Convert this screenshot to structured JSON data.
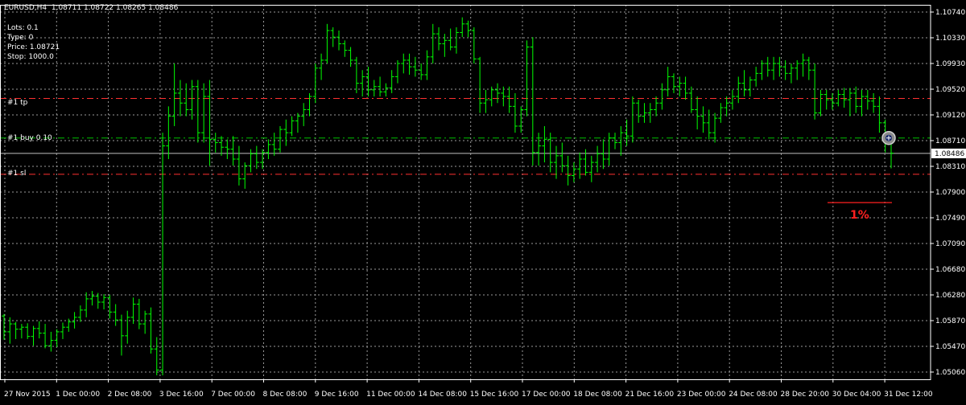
{
  "header": {
    "symbol": "EURUSD,H4",
    "ohlc": "1.08711 1.08722 1.08265 1.08486"
  },
  "trade_info": {
    "lots": "Lots: 0.1",
    "type": "Type: 0",
    "price": "Price: 1.08721",
    "stop": "Stop: 1000.0"
  },
  "levels": {
    "tp_label": "#1 tp",
    "buy_label": "#1 buy 0.10",
    "sl_label": "#1 sl"
  },
  "percent_label": "1%",
  "colors": {
    "background": "#000000",
    "grid": "#9a9a9a",
    "bars": "#00ff00",
    "tp_line": "#ff3030",
    "sl_line": "#ff3030",
    "buy_line": "#00c000",
    "current_price_line": "#c0c0c0",
    "percent_line": "#ff2020"
  },
  "chart_data": {
    "type": "ohlc",
    "ylim": [
      1.0506,
      1.1074
    ],
    "y_ticks": [
      "1.10740",
      "1.10330",
      "1.09930",
      "1.09520",
      "1.09120",
      "1.08710",
      "1.08310",
      "1.07900",
      "1.07490",
      "1.07090",
      "1.06680",
      "1.06280",
      "1.05870",
      "1.05470",
      "1.05060"
    ],
    "current_price": "1.08486",
    "tp_price": 1.0932,
    "buy_price": 1.0872,
    "sl_price": 1.0817,
    "percent_line_price": 1.0774,
    "x_ticks": [
      "27 Nov 2015",
      "1 Dec 00:00",
      "2 Dec 08:00",
      "3 Dec 16:00",
      "7 Dec 00:00",
      "8 Dec 08:00",
      "9 Dec 16:00",
      "11 Dec 00:00",
      "14 Dec 08:00",
      "15 Dec 16:00",
      "17 Dec 00:00",
      "18 Dec 08:00",
      "21 Dec 16:00",
      "23 Dec 00:00",
      "24 Dec 08:00",
      "28 Dec 20:00",
      "30 Dec 04:00",
      "31 Dec 12:00"
    ],
    "bars": [
      [
        1.0602,
        1.0605,
        1.0566,
        1.0578
      ],
      [
        1.0578,
        1.06,
        1.056,
        1.059
      ],
      [
        1.059,
        1.0593,
        1.0567,
        1.0582
      ],
      [
        1.0582,
        1.059,
        1.0568,
        1.0585
      ],
      [
        1.0585,
        1.0591,
        1.0567,
        1.0571
      ],
      [
        1.0571,
        1.0587,
        1.0557,
        1.0583
      ],
      [
        1.0583,
        1.0594,
        1.0568,
        1.0576
      ],
      [
        1.0576,
        1.059,
        1.0553,
        1.0557
      ],
      [
        1.0557,
        1.0578,
        1.0548,
        1.0565
      ],
      [
        1.0565,
        1.0582,
        1.0555,
        1.0578
      ],
      [
        1.0578,
        1.0592,
        1.0567,
        1.0585
      ],
      [
        1.0585,
        1.0598,
        1.0578,
        1.0593
      ],
      [
        1.0593,
        1.0608,
        1.0583,
        1.06
      ],
      [
        1.06,
        1.0618,
        1.0593,
        1.0611
      ],
      [
        1.0611,
        1.0638,
        1.06,
        1.0628
      ],
      [
        1.0628,
        1.064,
        1.0618,
        1.0632
      ],
      [
        1.0632,
        1.0637,
        1.0613,
        1.0623
      ],
      [
        1.0623,
        1.0635,
        1.0612,
        1.063
      ],
      [
        1.063,
        1.0634,
        1.0598,
        1.0608
      ],
      [
        1.0608,
        1.062,
        1.0587,
        1.0596
      ],
      [
        1.0596,
        1.0604,
        1.0542,
        1.0572
      ],
      [
        1.0572,
        1.061,
        1.056,
        1.06
      ],
      [
        1.06,
        1.063,
        1.059,
        1.062
      ],
      [
        1.062,
        1.0628,
        1.0582,
        1.059
      ],
      [
        1.059,
        1.061,
        1.0575,
        1.0605
      ],
      [
        1.0605,
        1.0615,
        1.0545,
        1.0552
      ],
      [
        1.0552,
        1.057,
        1.0512,
        1.052
      ],
      [
        1.052,
        1.088,
        1.0512,
        1.086
      ],
      [
        1.086,
        1.092,
        1.084,
        1.0905
      ],
      [
        1.0905,
        1.0985,
        1.089,
        1.094
      ],
      [
        1.094,
        1.096,
        1.0905,
        1.0925
      ],
      [
        1.0925,
        1.0955,
        1.0905,
        1.0915
      ],
      [
        1.0915,
        1.096,
        1.09,
        1.095
      ],
      [
        1.095,
        1.096,
        1.0865,
        1.088
      ],
      [
        1.088,
        1.0955,
        1.0865,
        1.0935
      ],
      [
        1.0935,
        1.096,
        1.083,
        1.087
      ],
      [
        1.087,
        1.088,
        1.085,
        1.0865
      ],
      [
        1.0865,
        1.0875,
        1.0845,
        1.0858
      ],
      [
        1.0858,
        1.087,
        1.084,
        1.0855
      ],
      [
        1.0855,
        1.0875,
        1.083,
        1.084
      ],
      [
        1.084,
        1.086,
        1.08,
        1.081
      ],
      [
        1.081,
        1.0835,
        1.0795,
        1.083
      ],
      [
        1.083,
        1.0855,
        1.082,
        1.0848
      ],
      [
        1.0848,
        1.086,
        1.0825,
        1.0835
      ],
      [
        1.0835,
        1.0855,
        1.0825,
        1.085
      ],
      [
        1.085,
        1.087,
        1.084,
        1.0862
      ],
      [
        1.0862,
        1.088,
        1.0845,
        1.0855
      ],
      [
        1.0855,
        1.089,
        1.085,
        1.0885
      ],
      [
        1.0885,
        1.09,
        1.086,
        1.088
      ],
      [
        1.088,
        1.0905,
        1.0875,
        1.0898
      ],
      [
        1.0898,
        1.091,
        1.088,
        1.0905
      ],
      [
        1.0905,
        1.0925,
        1.089,
        1.0915
      ],
      [
        1.0915,
        1.094,
        1.0905,
        1.0935
      ],
      [
        1.0935,
        1.0985,
        1.0925,
        1.0978
      ],
      [
        1.0978,
        1.1,
        1.096,
        1.099
      ],
      [
        1.099,
        1.1045,
        1.0985,
        1.1035
      ],
      [
        1.1035,
        1.104,
        1.101,
        1.1025
      ],
      [
        1.1025,
        1.1035,
        1.1005,
        1.1015
      ],
      [
        1.1015,
        1.102,
        1.0995,
        1.1005
      ],
      [
        1.1005,
        1.101,
        1.098,
        1.099
      ],
      [
        1.099,
        1.0995,
        1.094,
        1.0955
      ],
      [
        1.0955,
        1.0975,
        1.0935,
        1.0965
      ],
      [
        1.0965,
        1.098,
        1.0935,
        1.0945
      ],
      [
        1.0945,
        1.096,
        1.0935,
        1.095
      ],
      [
        1.095,
        1.0965,
        1.0935,
        1.0942
      ],
      [
        1.0942,
        1.0955,
        1.0935,
        1.0948
      ],
      [
        1.0948,
        1.0975,
        1.094,
        1.0965
      ],
      [
        1.0965,
        1.099,
        1.0955,
        1.0985
      ],
      [
        1.0985,
        1.1,
        1.097,
        1.099
      ],
      [
        1.099,
        1.1,
        1.0968,
        1.098
      ],
      [
        1.098,
        1.0995,
        1.0965,
        1.0975
      ],
      [
        1.0975,
        1.0985,
        1.096,
        1.0968
      ],
      [
        1.0968,
        1.1005,
        1.096,
        1.0995
      ],
      [
        1.0995,
        1.1045,
        1.0985,
        1.103
      ],
      [
        1.103,
        1.104,
        1.1005,
        1.1015
      ],
      [
        1.1015,
        1.103,
        1.0995,
        1.102
      ],
      [
        1.102,
        1.1038,
        1.1005,
        1.101
      ],
      [
        1.101,
        1.104,
        1.1,
        1.1032
      ],
      [
        1.1032,
        1.1055,
        1.1025,
        1.1045
      ],
      [
        1.1045,
        1.105,
        1.1025,
        1.1035
      ],
      [
        1.1035,
        1.104,
        1.0985,
        1.0992
      ],
      [
        1.0992,
        1.0995,
        1.091,
        1.0925
      ],
      [
        1.0925,
        1.0945,
        1.091,
        1.093
      ],
      [
        1.093,
        1.095,
        1.092,
        1.0945
      ],
      [
        1.0945,
        1.0955,
        1.0925,
        1.094
      ],
      [
        1.094,
        1.095,
        1.092,
        1.0935
      ],
      [
        1.0935,
        1.095,
        1.091,
        1.092
      ],
      [
        1.092,
        1.094,
        1.088,
        1.089
      ],
      [
        1.089,
        1.092,
        1.088,
        1.0915
      ],
      [
        1.0915,
        1.102,
        1.0905,
        1.101
      ],
      [
        1.101,
        1.1025,
        1.083,
        1.085
      ],
      [
        1.085,
        1.088,
        1.083,
        1.086
      ],
      [
        1.086,
        1.089,
        1.0835,
        1.087
      ],
      [
        1.087,
        1.088,
        1.082,
        1.0835
      ],
      [
        1.0835,
        1.086,
        1.081,
        1.0845
      ],
      [
        1.0845,
        1.0865,
        1.082,
        1.083
      ],
      [
        1.083,
        1.0845,
        1.08,
        1.0815
      ],
      [
        1.0815,
        1.0835,
        1.0805,
        1.0825
      ],
      [
        1.0825,
        1.085,
        1.081,
        1.084
      ],
      [
        1.084,
        1.0855,
        1.0815,
        1.082
      ],
      [
        1.082,
        1.0845,
        1.0805,
        1.0835
      ],
      [
        1.0835,
        1.086,
        1.082,
        1.0848
      ],
      [
        1.0848,
        1.087,
        1.0825,
        1.084
      ],
      [
        1.084,
        1.088,
        1.083,
        1.0872
      ],
      [
        1.0872,
        1.088,
        1.0855,
        1.0865
      ],
      [
        1.0865,
        1.089,
        1.0845,
        1.088
      ],
      [
        1.088,
        1.09,
        1.086,
        1.0875
      ],
      [
        1.0875,
        1.0935,
        1.0865,
        1.0925
      ],
      [
        1.0925,
        1.093,
        1.0895,
        1.0905
      ],
      [
        1.0905,
        1.0925,
        1.0895,
        1.091
      ],
      [
        1.091,
        1.0925,
        1.0895,
        1.0915
      ],
      [
        1.0915,
        1.0935,
        1.0905,
        1.0925
      ],
      [
        1.0925,
        1.0955,
        1.0915,
        1.0945
      ],
      [
        1.0945,
        1.098,
        1.0935,
        1.0965
      ],
      [
        1.0965,
        1.097,
        1.094,
        1.095
      ],
      [
        1.095,
        1.0965,
        1.0935,
        1.0955
      ],
      [
        1.0955,
        1.0965,
        1.093,
        1.094
      ],
      [
        1.094,
        1.095,
        1.091,
        1.0915
      ],
      [
        1.0915,
        1.0935,
        1.0885,
        1.0905
      ],
      [
        1.0905,
        1.092,
        1.088,
        1.0895
      ],
      [
        1.0895,
        1.0915,
        1.087,
        1.088
      ],
      [
        1.088,
        1.091,
        1.0865,
        1.0902
      ],
      [
        1.0902,
        1.0925,
        1.0895,
        1.0918
      ],
      [
        1.0918,
        1.0935,
        1.0905,
        1.0925
      ],
      [
        1.0925,
        1.0945,
        1.0915,
        1.0935
      ],
      [
        1.0935,
        1.0965,
        1.0925,
        1.0955
      ],
      [
        1.0955,
        1.0975,
        1.0935,
        1.0945
      ],
      [
        1.0945,
        1.0965,
        1.0935,
        1.096
      ],
      [
        1.096,
        1.098,
        1.095,
        1.097
      ],
      [
        1.097,
        1.099,
        1.096,
        1.0985
      ],
      [
        1.0985,
        1.0995,
        1.0965,
        1.0975
      ],
      [
        1.0975,
        1.0995,
        1.096,
        1.0985
      ],
      [
        1.0985,
        1.0995,
        1.0965,
        1.098
      ],
      [
        1.098,
        1.099,
        1.096,
        1.097
      ],
      [
        1.097,
        1.0985,
        1.0955,
        1.0978
      ],
      [
        1.0978,
        1.099,
        1.096,
        1.0985
      ],
      [
        1.0985,
        1.1,
        1.0965,
        1.099
      ],
      [
        1.099,
        1.0995,
        1.096,
        1.0975
      ],
      [
        1.0975,
        1.0985,
        1.09,
        1.091
      ],
      [
        1.091,
        1.0945,
        1.0905,
        1.0938
      ],
      [
        1.0938,
        1.0945,
        1.0915,
        1.093
      ],
      [
        1.093,
        1.094,
        1.0915,
        1.0925
      ],
      [
        1.0925,
        1.0945,
        1.092,
        1.0938
      ],
      [
        1.0938,
        1.0948,
        1.0918,
        1.093
      ],
      [
        1.093,
        1.0948,
        1.0905,
        1.094
      ],
      [
        1.094,
        1.095,
        1.091,
        1.092
      ],
      [
        1.092,
        1.0945,
        1.0905,
        1.0935
      ],
      [
        1.0935,
        1.0945,
        1.0915,
        1.0928
      ],
      [
        1.0928,
        1.094,
        1.091,
        1.092
      ],
      [
        1.092,
        1.0935,
        1.088,
        1.0895
      ],
      [
        1.0895,
        1.09,
        1.085,
        1.0871
      ],
      [
        1.0871,
        1.0872,
        1.0826,
        1.0849
      ]
    ]
  }
}
